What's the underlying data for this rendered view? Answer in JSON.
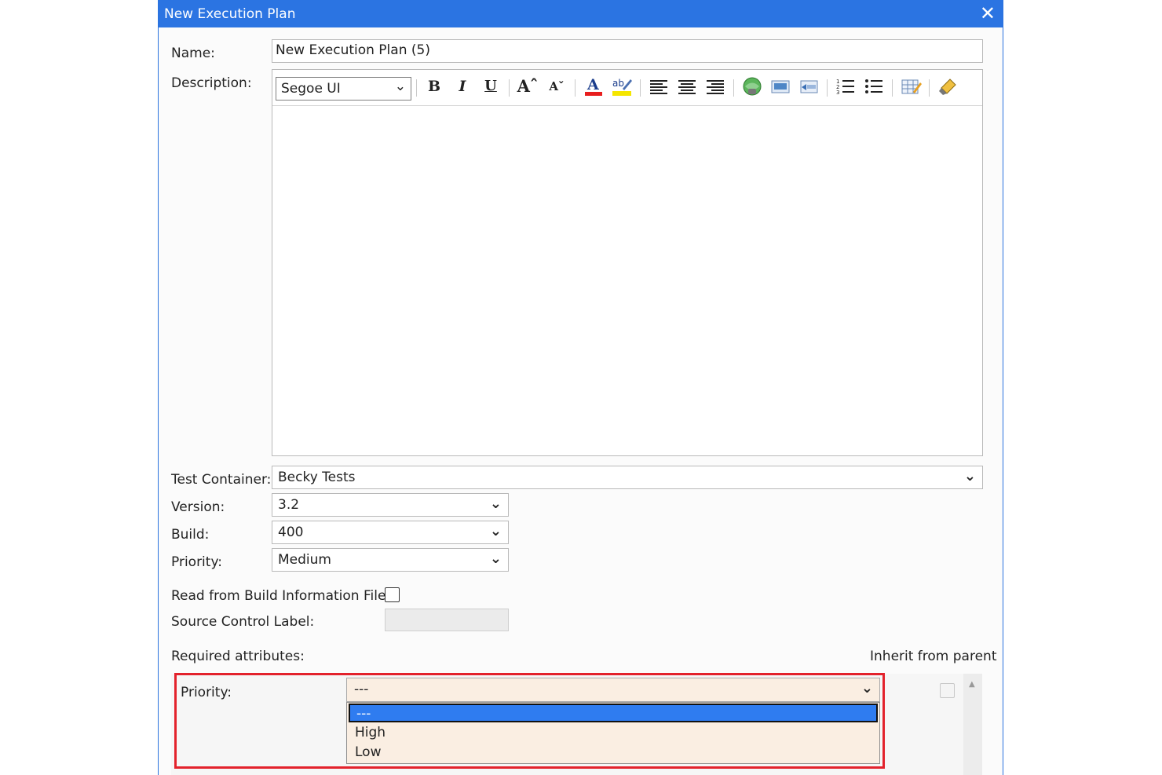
{
  "window": {
    "title": "New Execution Plan",
    "close_glyph": "✕"
  },
  "form": {
    "name_label": "Name:",
    "name_value": "New Execution Plan (5)",
    "description_label": "Description:",
    "editor": {
      "font_value": "Segoe UI",
      "toolbar_icons": [
        "bold-icon",
        "italic-icon",
        "underline-icon",
        "grow-font-icon",
        "shrink-font-icon",
        "font-color-icon",
        "highlight-icon",
        "align-left-icon",
        "align-center-icon",
        "align-right-icon",
        "insert-hyperlink-icon",
        "insert-image-icon",
        "insert-picture-icon",
        "numbered-list-icon",
        "bulleted-list-icon",
        "insert-table-icon",
        "clear-format-icon"
      ],
      "text": ""
    },
    "test_container_label": "Test Container:",
    "test_container_value": "Becky Tests",
    "version_label": "Version:",
    "version_value": "3.2",
    "build_label": "Build:",
    "build_value": "400",
    "priority_label": "Priority:",
    "priority_value": "Medium",
    "read_build_label": "Read from Build Information File:",
    "read_build_checked": false,
    "source_control_label": "Source Control Label:",
    "source_control_value": ""
  },
  "attributes": {
    "required_label": "Required attributes:",
    "inherit_label": "Inherit from parent",
    "priority_label": "Priority:",
    "priority_selected": "---",
    "options": [
      "---",
      "High",
      "Low"
    ],
    "highlighted_option": "---"
  },
  "colors": {
    "titlebar": "#2b74e2",
    "highlight_border": "#e3222c",
    "dropdown_bg": "#faeee2",
    "selected_option": "#2f7cf0"
  }
}
